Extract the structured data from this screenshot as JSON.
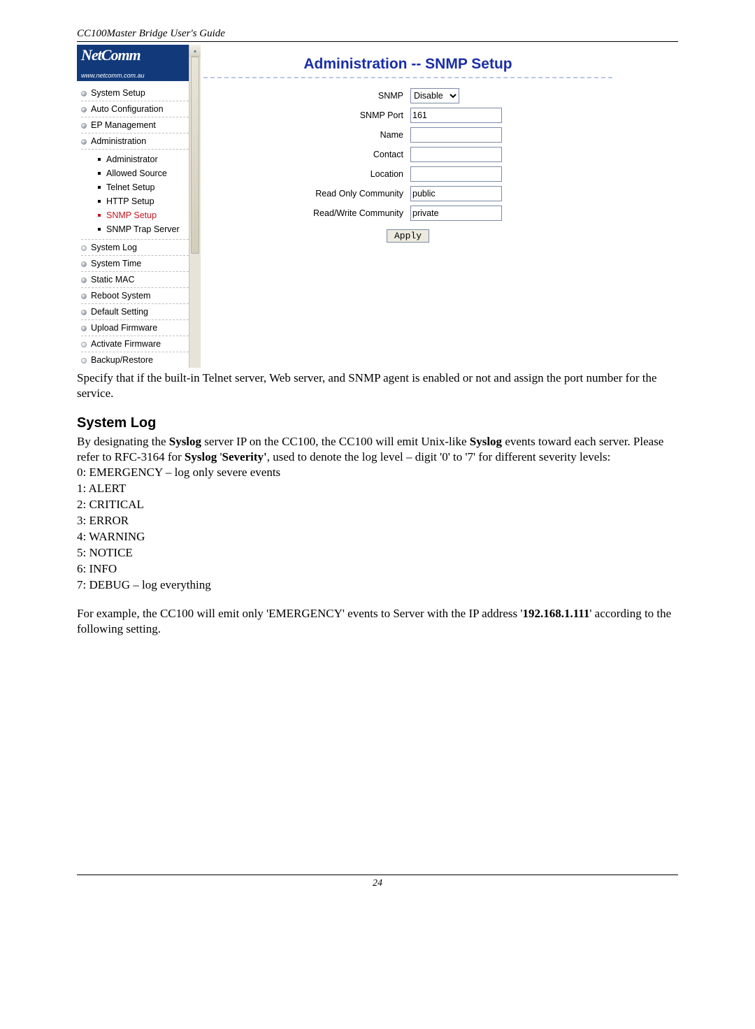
{
  "header": {
    "guide_title": "CC100Master Bridge User's Guide"
  },
  "logo": {
    "brand": "NetComm",
    "url": "www.netcomm.com.au"
  },
  "nav": {
    "items": [
      "System Setup",
      "Auto Configuration",
      "EP Management",
      "Administration",
      "System Log",
      "System Time",
      "Static MAC",
      "Reboot System",
      "Default Setting",
      "Upload Firmware",
      "Activate Firmware",
      "Backup/Restore"
    ],
    "admin_sub": [
      "Administrator",
      "Allowed Source",
      "Telnet Setup",
      "HTTP Setup",
      "SNMP Setup",
      "SNMP Trap Server"
    ]
  },
  "main": {
    "title": "Administration -- SNMP Setup",
    "rows": {
      "snmp": "SNMP",
      "snmp_port": "SNMP Port",
      "name": "Name",
      "contact": "Contact",
      "location": "Location",
      "ro_comm": "Read Only Community",
      "rw_comm": "Read/Write Community"
    },
    "values": {
      "snmp_select": "Disable",
      "snmp_port": "161",
      "name": "",
      "contact": "",
      "location": "",
      "ro_comm": "public",
      "rw_comm": "private"
    },
    "apply": "Apply"
  },
  "doc": {
    "para1": "Specify that if the built-in Telnet server, Web server, and SNMP agent is enabled or not and assign the port number for the service.",
    "section": "System Log",
    "para2a": "By designating the ",
    "para2b": "Syslog",
    "para2c": " server IP on the CC100, the CC100 will emit Unix-like ",
    "para2d": "Syslog",
    "para2e": " events toward each server. Please refer to RFC-3164 for ",
    "para2f": "Syslog",
    "para2g": " '",
    "para2h": "Severity'",
    "para2i": ", used to denote the log level – digit '0' to '7' for different severity levels:",
    "levels": [
      "0: EMERGENCY – log only severe events",
      "1: ALERT",
      "2: CRITICAL",
      "3: ERROR",
      "4: WARNING",
      "5: NOTICE",
      "6: INFO",
      "7: DEBUG – log everything"
    ],
    "para3a": "For example, the CC100 will emit only 'EMERGENCY' events to Server with the IP address '",
    "para3b": "192.168.1.111",
    "para3c": "' according to the following setting."
  },
  "footer": {
    "page": "24"
  }
}
